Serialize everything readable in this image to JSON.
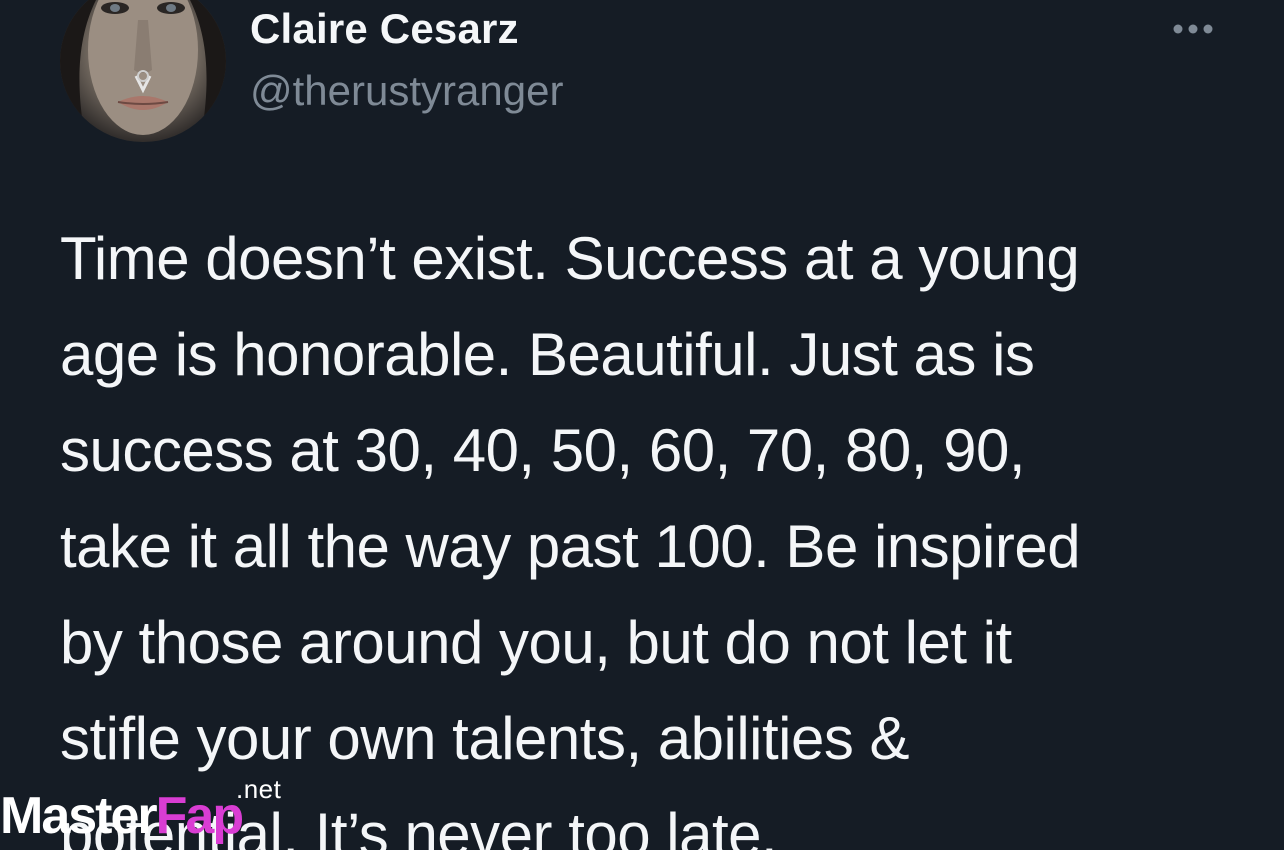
{
  "profile": {
    "display_name": "Claire Cesarz",
    "handle": "@therustyranger",
    "avatar_icon": "profile-photo"
  },
  "more_options": {
    "icon": "more-horizontal-icon"
  },
  "tweet": {
    "lines": [
      "Time doesn’t exist. Success at a young",
      "age is honorable. Beautiful. Just as is",
      "success at 30, 40, 50, 60, 70, 80, 90,",
      "take it all the way past 100. Be inspired",
      "by those around you, but do not let it",
      "stifle your own talents, abilities &",
      "potential. It’s never too late."
    ]
  },
  "watermark": {
    "tld": ".net",
    "brand_part1": "Master",
    "brand_part2": "Fap"
  },
  "colors": {
    "background": "#151c25",
    "text_primary": "#f4f6f8",
    "text_secondary": "#7f8a96",
    "watermark_accent": "#d93dd3"
  }
}
